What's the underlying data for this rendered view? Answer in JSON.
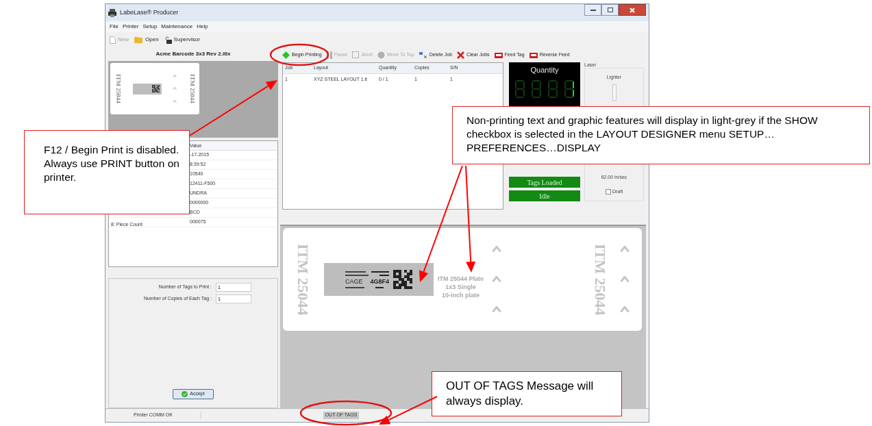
{
  "window": {
    "title": "LabeLase® Producer"
  },
  "menu": [
    "File",
    "Printer",
    "Setup",
    "Maintenance",
    "Help"
  ],
  "toolbar": [
    {
      "label": "New",
      "kind": "new",
      "disabled": true
    },
    {
      "label": "Open",
      "kind": "open",
      "disabled": false
    },
    {
      "label": "Supervisor",
      "kind": "lock",
      "disabled": false
    }
  ],
  "layout_panel": {
    "title": "Acme Barcode 3x3 Rev 2.itlx",
    "thumbnail": {
      "side_labels": [
        "ITM 25044",
        "ITM 25044"
      ]
    }
  },
  "fields_table": {
    "value_header": "Value",
    "rows": [
      {
        "value": "-17-2015"
      },
      {
        "value": "8:39:52"
      },
      {
        "value": "10540"
      },
      {
        "value": "12411-F500"
      },
      {
        "value": "UNDRA"
      },
      {
        "value": "0000000"
      },
      {
        "value": "BCD"
      },
      {
        "field": "8: Piece Count",
        "value": "000075"
      }
    ]
  },
  "print_form": {
    "fields": [
      {
        "label": "Number of Tags to Print :",
        "value": "1"
      },
      {
        "label": "Number of Copies of Each Tag :",
        "value": "1"
      }
    ],
    "accept": "Accept"
  },
  "job_toolbar": [
    {
      "label": "Begin Printing",
      "kind": "start",
      "disabled": false
    },
    {
      "label": "Pause",
      "kind": "pause",
      "disabled": true
    },
    {
      "label": "Abort",
      "kind": "abort",
      "disabled": true
    },
    {
      "label": "Move To Top",
      "kind": "up",
      "disabled": true
    },
    {
      "label": "Delete Job",
      "kind": "delete",
      "disabled": false
    },
    {
      "label": "Clear Jobs",
      "kind": "clear",
      "disabled": false
    },
    {
      "label": "Feed Tag",
      "kind": "feed",
      "disabled": false
    },
    {
      "label": "Reverse Feed",
      "kind": "feed",
      "disabled": false
    }
  ],
  "jobs_table": {
    "columns": [
      "Job",
      "Layout",
      "Quantity",
      "Copies",
      "S/N"
    ],
    "rows": [
      [
        "1",
        "XYZ STEEL LAYOUT 1.it",
        "0 / 1",
        "1",
        "1"
      ]
    ]
  },
  "status_panel": {
    "title": "Quantity",
    "states": [
      "Tags Loaded",
      "Idle"
    ]
  },
  "laser": {
    "title": "Laser",
    "slider_label": "Lighter",
    "speed": "62.00 in/sec",
    "draft": {
      "label": "Draft",
      "checked": false
    }
  },
  "preview": {
    "side_labels": [
      "ITM 25044",
      "ITM 25044"
    ],
    "barcode": {
      "label": "CAGE",
      "code": "4G8F4"
    },
    "plate_text": [
      "ITM 25044 Plate",
      "1x3 Single",
      "10-inch plate"
    ]
  },
  "status_bar": [
    {
      "text": "Printer COMM OK",
      "highlighted": false
    },
    {
      "text": "OUT OF TAGS",
      "highlighted": true
    }
  ],
  "annotations": [
    {
      "text": "F12 / Begin Print is disabled. Always use PRINT button on printer."
    },
    {
      "text": "Non-printing text and graphic features will display in light-grey if the SHOW checkbox is selected in the LAYOUT DESIGNER menu SETUP…PREFERENCES…DISPLAY"
    },
    {
      "text": "OUT OF TAGS Message will always display."
    }
  ]
}
